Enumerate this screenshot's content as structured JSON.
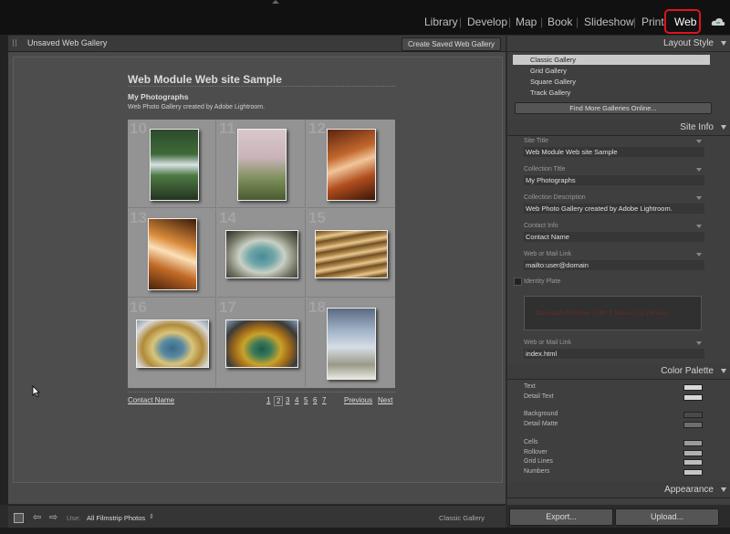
{
  "modules": {
    "library": "Library",
    "develop": "Develop",
    "map": "Map",
    "book": "Book",
    "slideshow": "Slideshow",
    "print": "Print",
    "web": "Web",
    "separator": "|"
  },
  "preview_header": {
    "title": "Unsaved Web Gallery",
    "save_button": "Create Saved Web Gallery"
  },
  "gallery": {
    "site_title": "Web Module Web site Sample",
    "collection_title": "My Photographs",
    "description": "Web Photo Gallery created by Adobe Lightroom.",
    "cells": [
      {
        "num": "10"
      },
      {
        "num": "11"
      },
      {
        "num": "12"
      },
      {
        "num": "13"
      },
      {
        "num": "14"
      },
      {
        "num": "15"
      },
      {
        "num": "16"
      },
      {
        "num": "17"
      },
      {
        "num": "18"
      }
    ],
    "contact_link": "Contact Name",
    "pages": [
      "1",
      "2",
      "3",
      "4",
      "5",
      "6",
      "7"
    ],
    "current_page": "2",
    "prev": "Previous",
    "next": "Next"
  },
  "layout_style": {
    "header": "Layout Style",
    "items": [
      "Classic Gallery",
      "Grid Gallery",
      "Square Gallery",
      "Track Gallery"
    ],
    "selected": "Classic Gallery",
    "find_more": "Find More Galleries Online..."
  },
  "site_info": {
    "header": "Site Info",
    "site_title_label": "Site Title",
    "site_title": "Web Module Web site Sample",
    "collection_title_label": "Collection Title",
    "collection_title": "My Photographs",
    "collection_desc_label": "Collection Description",
    "collection_desc": "Web Photo Gallery created by Adobe Lightroom.",
    "contact_info_label": "Contact Info",
    "contact_info": "Contact Name",
    "mail_link_label": "Web or Mail Link",
    "mail_link": "mailto:user@domain",
    "identity_plate_label": "Identity Plate",
    "identity_plate_text": "Dan Hatfield Photo · CRS 1 Master Cal (Retina)",
    "web_link_label": "Web or Mail Link",
    "web_link": "index.html"
  },
  "color_palette": {
    "header": "Color Palette",
    "items": [
      {
        "label": "Text",
        "color": "#d8d8d8"
      },
      {
        "label": "Detail Text",
        "color": "#d8d8d8"
      },
      {
        "label": "Background",
        "color": "#4a4a4a"
      },
      {
        "label": "Detail Matte",
        "color": "#6e6e6e"
      },
      {
        "label": "Cells",
        "color": "#9a9a9a"
      },
      {
        "label": "Rollover",
        "color": "#b0b0b0"
      },
      {
        "label": "Grid Lines",
        "color": "#bdbdbd"
      },
      {
        "label": "Numbers",
        "color": "#c6c6c6"
      }
    ]
  },
  "appearance": {
    "header": "Appearance"
  },
  "toolbar": {
    "use_label": "Use:",
    "use_value": "All Filmstrip Photos",
    "style_status": "Classic Gallery"
  },
  "actions": {
    "export": "Export...",
    "upload": "Upload..."
  },
  "colors": {
    "accent_highlight": "#e0141c"
  },
  "icons": {
    "stop": "stop-icon",
    "prev": "arrow-left-icon",
    "next": "arrow-right-icon",
    "cursor": "mouse-cursor-icon"
  }
}
